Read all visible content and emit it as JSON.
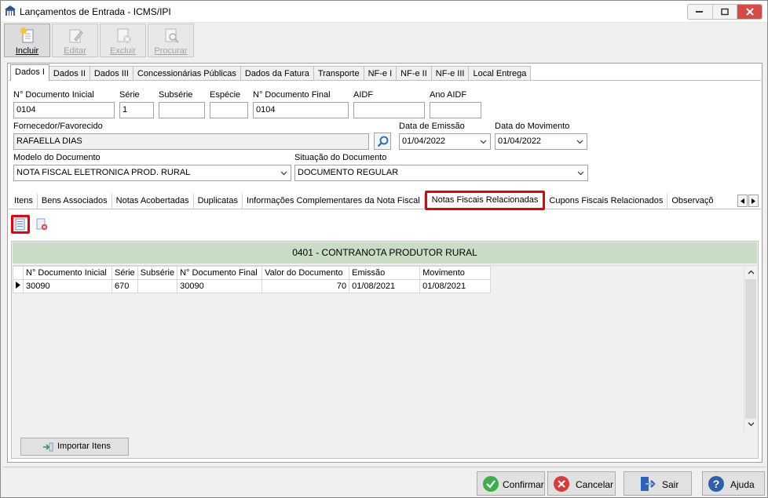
{
  "window": {
    "title": "Lançamentos de Entrada - ICMS/IPI"
  },
  "toolbar": {
    "incluir": "Incluir",
    "editar": "Editar",
    "excluir": "Excluir",
    "procurar": "Procurar"
  },
  "tabs": [
    "Dados I",
    "Dados II",
    "Dados III",
    "Concessionárias Públicas",
    "Dados da Fatura",
    "Transporte",
    "NF-e I",
    "NF-e II",
    "NF-e III",
    "Local Entrega"
  ],
  "form": {
    "doc_inicial_label": "N° Documento Inicial",
    "doc_inicial": "0104",
    "serie_label": "Série",
    "serie": "1",
    "subserie_label": "Subsérie",
    "subserie": "",
    "especie_label": "Espécie",
    "especie": "",
    "doc_final_label": "N° Documento Final",
    "doc_final": "0104",
    "aidf_label": "AIDF",
    "aidf": "",
    "ano_aidf_label": "Ano AIDF",
    "ano_aidf": "",
    "fornecedor_label": "Fornecedor/Favorecido",
    "fornecedor": "RAFAELLA DIAS",
    "data_emissao_label": "Data de Emissão",
    "data_emissao": "01/04/2022",
    "data_movimento_label": "Data do Movimento",
    "data_movimento": "01/04/2022",
    "modelo_label": "Modelo do Documento",
    "modelo": "NOTA FISCAL ELETRONICA PROD. RURAL",
    "situacao_label": "Situação do Documento",
    "situacao": "DOCUMENTO REGULAR"
  },
  "subtabs": [
    "Itens",
    "Bens Associados",
    "Notas Acobertadas",
    "Duplicatas",
    "Informações Complementares da Nota Fiscal",
    "Notas Fiscais Relacionadas",
    "Cupons Fiscais Relacionados",
    "Observaçõ"
  ],
  "related": {
    "header": "0401  -  CONTRANOTA PRODUTOR RURAL",
    "columns": [
      "N° Documento Inicial",
      "Série",
      "Subsérie",
      "N° Documento Final",
      "Valor do Documento",
      "Emissão",
      "Movimento"
    ],
    "rows": [
      {
        "doc_inicial": "30090",
        "serie": "670",
        "subserie": "",
        "doc_final": "30090",
        "valor": "70",
        "emissao": "01/08/2021",
        "movimento": "01/08/2021"
      }
    ],
    "import_label": "Importar Itens"
  },
  "footer": {
    "confirmar": "Confirmar",
    "cancelar": "Cancelar",
    "sair": "Sair",
    "ajuda": "Ajuda"
  },
  "colors": {
    "highlight": "#e8000b",
    "band": "#c9ddc5"
  }
}
